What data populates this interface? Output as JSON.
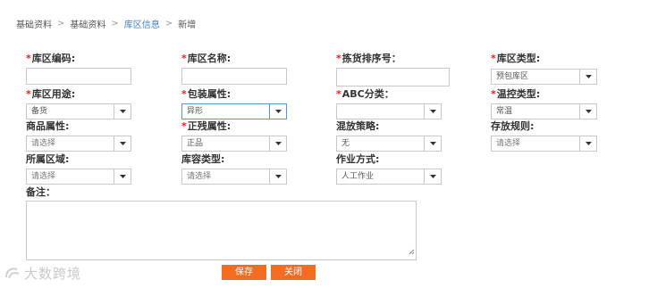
{
  "breadcrumb": {
    "items": [
      "基础资料",
      "基础资料",
      "库区信息",
      "新增"
    ],
    "separator": ">"
  },
  "required_mark": "*",
  "form": {
    "zone_code": {
      "label": "库区编码:",
      "value": ""
    },
    "zone_name": {
      "label": "库区名称:",
      "value": ""
    },
    "pick_sort": {
      "label": "拣货排序号：",
      "value": ""
    },
    "zone_type": {
      "label": "库区类型:",
      "value": "预包库区"
    },
    "zone_usage": {
      "label": "库区用途:",
      "value": "备货"
    },
    "package_attr": {
      "label": "包装属性:",
      "value": "异形"
    },
    "abc_class": {
      "label": "ABC分类：",
      "value": ""
    },
    "temp_type": {
      "label": "温控类型:",
      "value": "常温"
    },
    "goods_attr": {
      "label": "商品属性:",
      "value": "请选择"
    },
    "genuine_attr": {
      "label": "正残属性:",
      "value": "正品"
    },
    "mix_strategy": {
      "label": "混放策略:",
      "value": "无"
    },
    "storage_rule": {
      "label": "存放规则:",
      "value": "请选择"
    },
    "region": {
      "label": "所属区域:",
      "value": "请选择"
    },
    "capacity_type": {
      "label": "库容类型:",
      "value": "请选择"
    },
    "work_mode": {
      "label": "作业方式:",
      "value": "人工作业"
    },
    "remark": {
      "label": "备注：",
      "value": ""
    }
  },
  "buttons": {
    "save": "保存",
    "close": "关闭"
  },
  "watermark": {
    "text": "大数跨境"
  },
  "colors": {
    "accent": "#f26d21",
    "required": "#e02020",
    "link": "#3d7fc4",
    "focus_border": "#5b95d6"
  }
}
